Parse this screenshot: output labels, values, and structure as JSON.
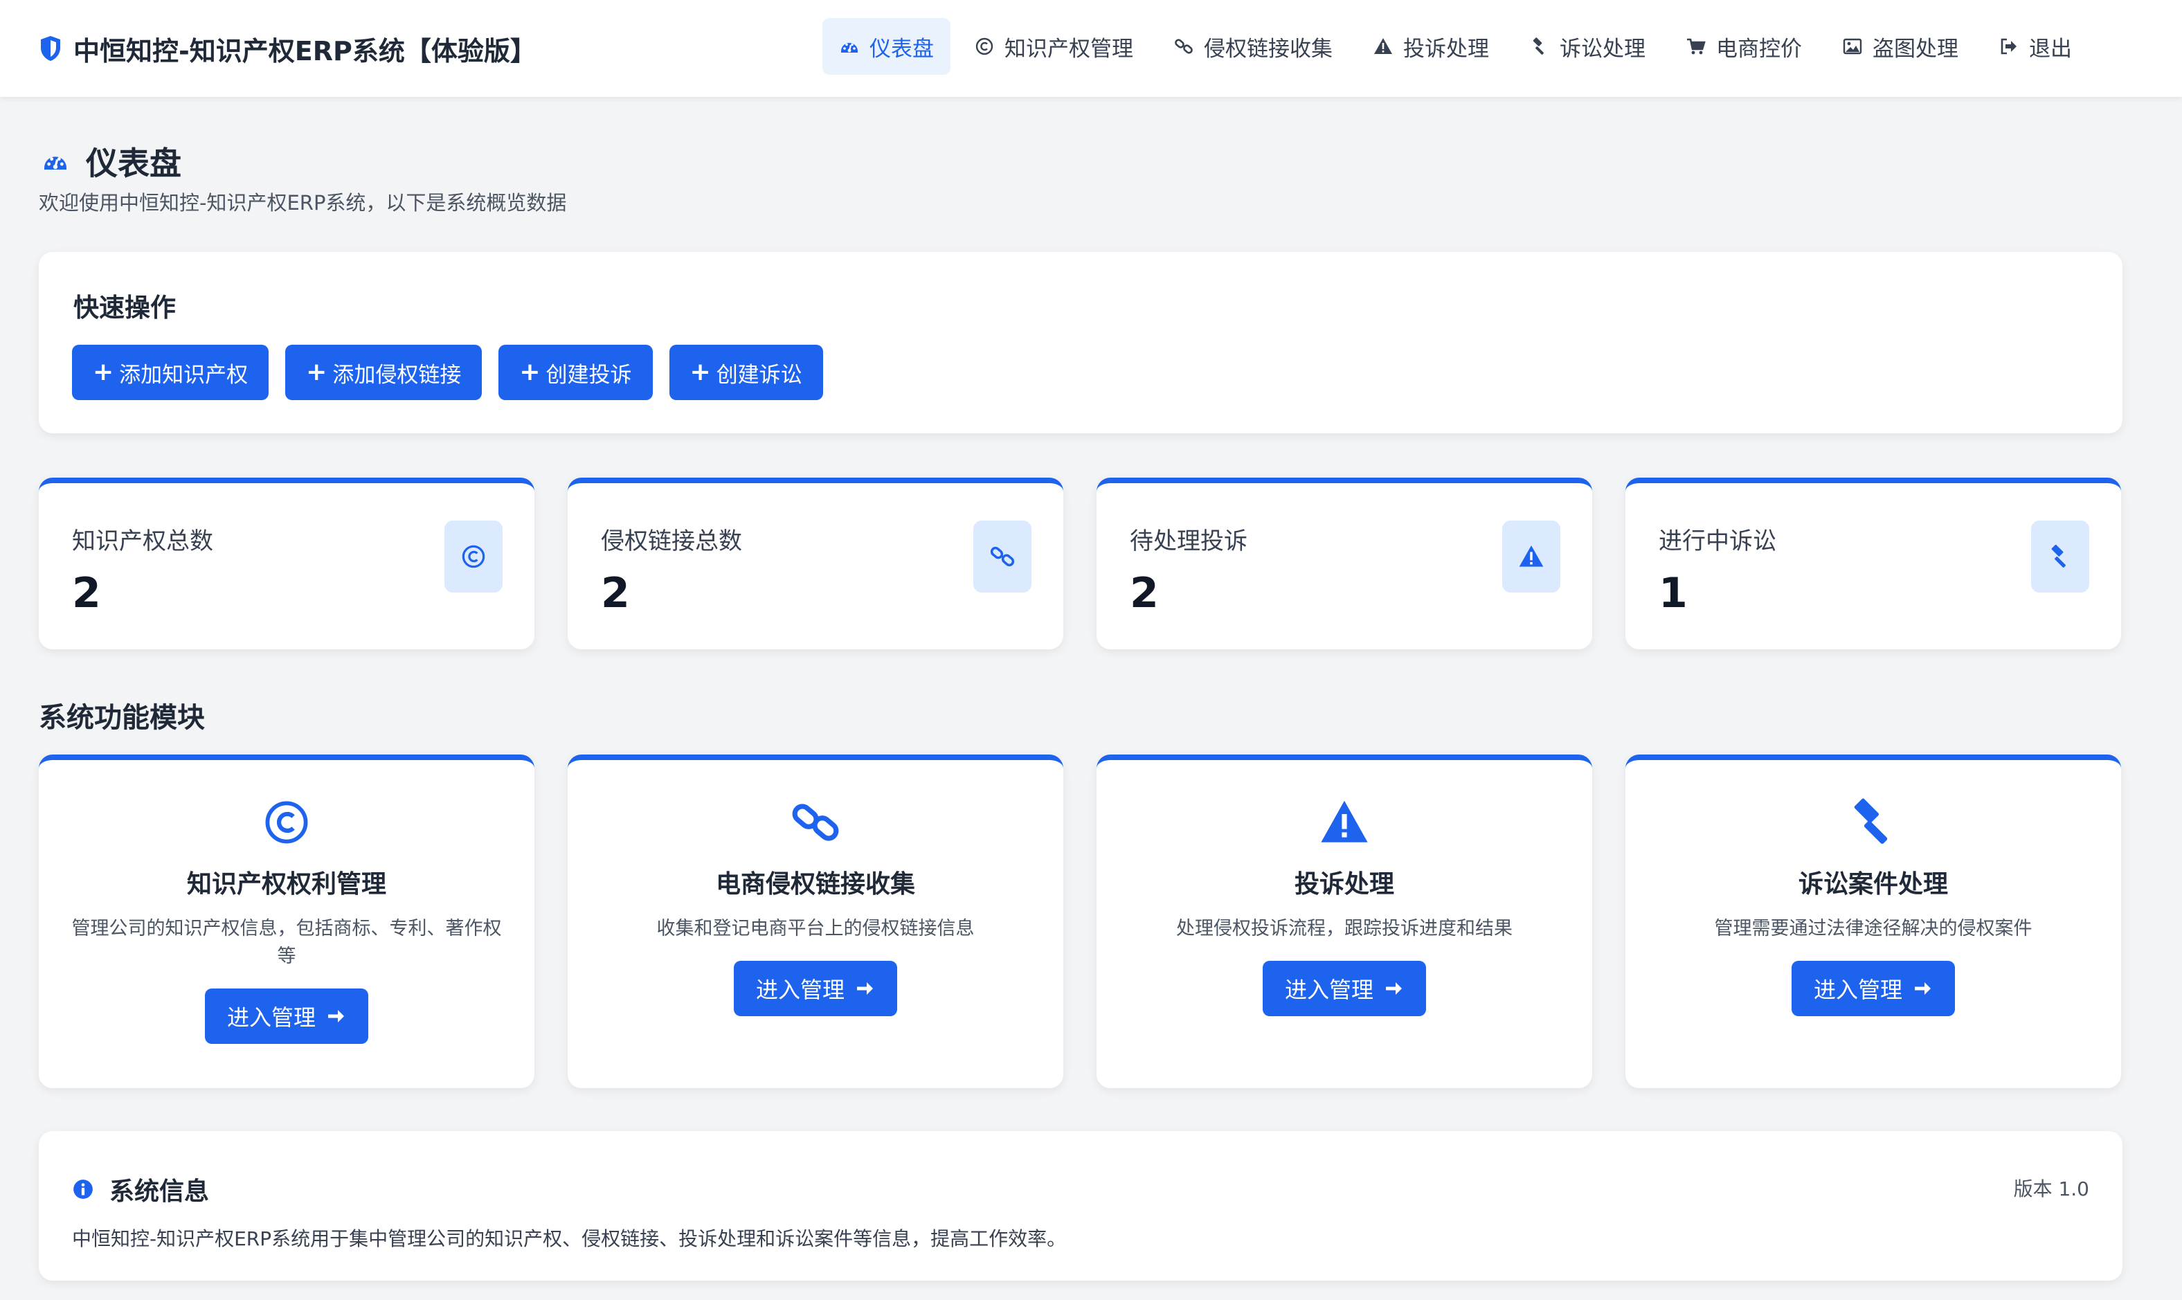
{
  "app": {
    "title": "中恒知控-知识产权ERP系统【体验版】",
    "icon": "shield-icon"
  },
  "nav": {
    "items": [
      {
        "label": "仪表盘",
        "icon": "dashboard-icon",
        "active": true
      },
      {
        "label": "知识产权管理",
        "icon": "copyright-icon"
      },
      {
        "label": "侵权链接收集",
        "icon": "link-icon"
      },
      {
        "label": "投诉处理",
        "icon": "warning-icon"
      },
      {
        "label": "诉讼处理",
        "icon": "gavel-icon"
      },
      {
        "label": "电商控价",
        "icon": "cart-icon"
      },
      {
        "label": "盗图处理",
        "icon": "image-icon"
      },
      {
        "label": "退出",
        "icon": "logout-icon"
      }
    ]
  },
  "page": {
    "title": "仪表盘",
    "subtitle": "欢迎使用中恒知控-知识产权ERP系统，以下是系统概览数据"
  },
  "quick_actions": {
    "title": "快速操作",
    "buttons": [
      {
        "label": "添加知识产权"
      },
      {
        "label": "添加侵权链接"
      },
      {
        "label": "创建投诉"
      },
      {
        "label": "创建诉讼"
      }
    ]
  },
  "stats": [
    {
      "label": "知识产权总数",
      "value": "2",
      "icon": "copyright-icon"
    },
    {
      "label": "侵权链接总数",
      "value": "2",
      "icon": "link-icon"
    },
    {
      "label": "待处理投诉",
      "value": "2",
      "icon": "warning-icon"
    },
    {
      "label": "进行中诉讼",
      "value": "1",
      "icon": "gavel-icon"
    }
  ],
  "modules": {
    "section_title": "系统功能模块",
    "items": [
      {
        "title": "知识产权权利管理",
        "desc": "管理公司的知识产权信息，包括商标、专利、著作权等",
        "button": "进入管理",
        "icon": "copyright-icon"
      },
      {
        "title": "电商侵权链接收集",
        "desc": "收集和登记电商平台上的侵权链接信息",
        "button": "进入管理",
        "icon": "link-icon"
      },
      {
        "title": "投诉处理",
        "desc": "处理侵权投诉流程，跟踪投诉进度和结果",
        "button": "进入管理",
        "icon": "warning-icon"
      },
      {
        "title": "诉讼案件处理",
        "desc": "管理需要通过法律途径解决的侵权案件",
        "button": "进入管理",
        "icon": "gavel-icon"
      }
    ]
  },
  "system_info": {
    "title": "系统信息",
    "version": "版本 1.0",
    "description": "中恒知控-知识产权ERP系统用于集中管理公司的知识产权、侵权链接、投诉处理和诉讼案件等信息，提高工作效率。"
  },
  "colors": {
    "accent": "#1d63ed",
    "accent_light": "#dbeafe",
    "background": "#f3f4f6"
  }
}
